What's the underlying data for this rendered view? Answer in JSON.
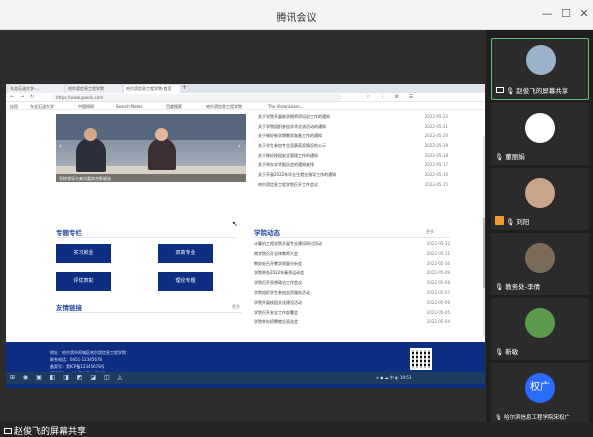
{
  "window": {
    "title": "腾讯会议",
    "minimize": "—",
    "maximize": "☐",
    "close": "✕"
  },
  "bottom": {
    "share_label": "赵俊飞的屏幕共享"
  },
  "browser": {
    "tabs": [
      "东北石油大学-...",
      "哈尔滨信息工程学院",
      "哈尔滨信息工程学院-首页"
    ],
    "new_tab": "+",
    "url": "https://www.gxedu.com",
    "nav": [
      "←",
      "→",
      "↻"
    ],
    "tools": "☆ ⋮ ⚙ ☰",
    "bookmarks": [
      "应用",
      "东北石油大学",
      "中国知网",
      "Search Notes",
      "百度搜索",
      "哈尔滨信息工程学院",
      "The VisionLearn..."
    ]
  },
  "page": {
    "photo_caption": "学校领导与来访嘉宾合影留念",
    "news": [
      {
        "title": "关于学院开展新学期师资培训工作的通知",
        "date": "2022-05-22"
      },
      {
        "title": "关于学院组织参加学术交流活动的通知",
        "date": "2022-05-21"
      },
      {
        "title": "关于做好新学期教学准备工作的通知",
        "date": "2022-05-20"
      },
      {
        "title": "关于学生参加专业竞赛获奖情况的公示",
        "date": "2022-05-19"
      },
      {
        "title": "关于做好校园安全管理工作的通知",
        "date": "2022-05-18"
      },
      {
        "title": "关于举办学术报告会的通知安排",
        "date": "2022-05-17"
      },
      {
        "title": "关于开展2022年毕业生就业指导工作的通知",
        "date": "2022-05-16"
      },
      {
        "title": "哈尔滨信息工程学院召开工作会议",
        "date": "2022-05-15"
      }
    ],
    "special_title": "专题专栏",
    "buttons": [
      "实习就业",
      "双高专业",
      "评优表彰",
      "理论专题"
    ],
    "links_title": "友情链接",
    "links_more": "更多",
    "dynamics_title": "学院动态",
    "dynamics_more": "更多",
    "dynamics": [
      {
        "title": "计算机工程学院开展专业建设研讨活动",
        "date": "2022-05-12"
      },
      {
        "title": "商学院召开全体教师大会",
        "date": "2022-05-11"
      },
      {
        "title": "教务处召开教学质量分析会",
        "date": "2022-05-10"
      },
      {
        "title": "学院举办2022年春季运动会",
        "date": "2022-05-09"
      },
      {
        "title": "学院召开思想政治工作会议",
        "date": "2022-05-08"
      },
      {
        "title": "学院组织学生参加志愿服务活动",
        "date": "2022-05-07"
      },
      {
        "title": "学院开展校园文化建设活动",
        "date": "2022-05-06"
      },
      {
        "title": "学院召开安全工作部署会",
        "date": "2022-05-05"
      },
      {
        "title": "学院举办招聘就业双选会",
        "date": "2022-05-04"
      }
    ],
    "footer_lines": [
      "地址：哈尔滨市阿城区哈尔滨信息工程学院",
      "联系电话：0451-12345678",
      "备案号：黑ICP备12345678号",
      "版权所有：哈尔滨信息工程学院"
    ],
    "qr_caption": "哈尔滨信息工程学院 微信公众号"
  },
  "taskbar": {
    "icons": "⊞ ◉ ▣ ◧ ◨ ◩ ◪ ◫ ◬",
    "tray": "∧ ◆ ☁ 中 ◐ 19:53"
  },
  "participants": [
    {
      "name": "赵俊飞的屏幕共享",
      "icon": "screen-icon",
      "active": true
    },
    {
      "name": "董丽娟",
      "icon": "mic-icon"
    },
    {
      "name": "刘阳",
      "icon": "mic-icon"
    },
    {
      "name": "教务处-李倩",
      "icon": "mic-icon"
    },
    {
      "name": "靳敏",
      "icon": "mic-icon"
    },
    {
      "name": "哈尔滨信息工程学院宋权广",
      "icon": "mic-icon",
      "avatar_text": "权广"
    }
  ]
}
